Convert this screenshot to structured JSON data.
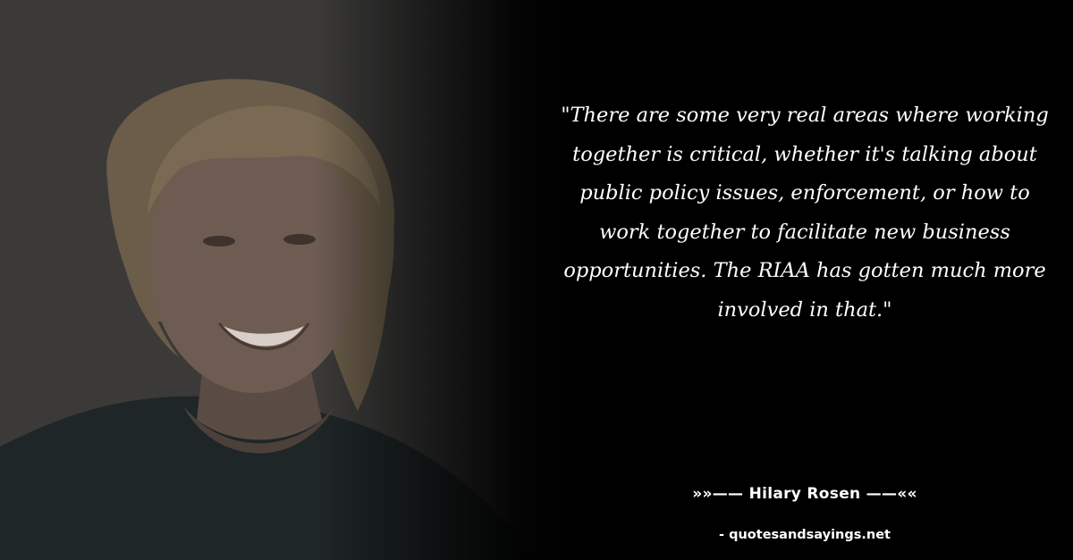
{
  "quote": {
    "text": "\"There are some very real areas where working together is critical, whether it's talking about public policy issues, enforcement, or how to work together to facilitate new business opportunities. The RIAA has gotten much more involved in that.\""
  },
  "author": {
    "label": "»»—— Hilary Rosen ——««"
  },
  "source": {
    "label": "- quotesandsayings.net"
  },
  "photo": {
    "subject": "portrait-of-smiling-woman",
    "background_color": "#3b3a39"
  },
  "colors": {
    "background": "#000000",
    "text": "#ffffff"
  }
}
